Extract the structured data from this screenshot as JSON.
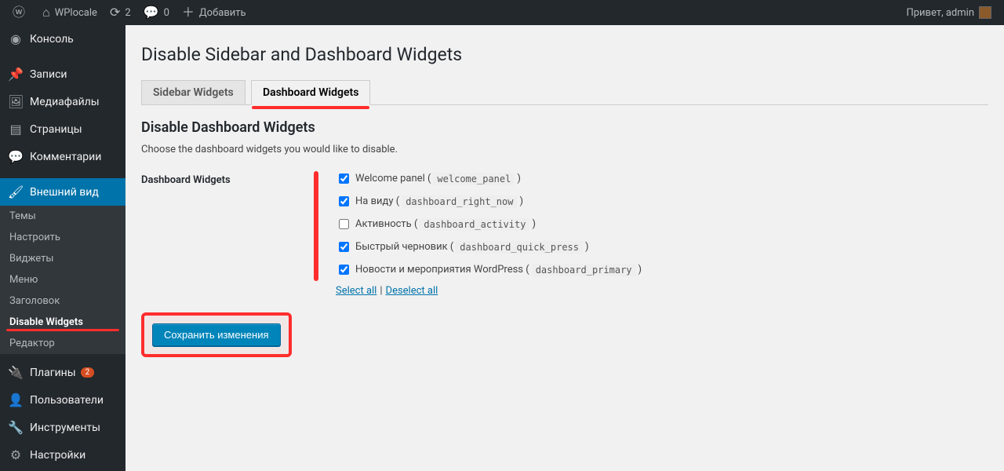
{
  "adminbar": {
    "site_name": "WPlocale",
    "updates": "2",
    "comments": "0",
    "add_new": "Добавить",
    "greeting": "Привет, admin"
  },
  "sidebar": {
    "dashboard": "Консоль",
    "posts": "Записи",
    "media": "Медиафайлы",
    "pages": "Страницы",
    "comments": "Комментарии",
    "appearance": "Внешний вид",
    "appearance_sub": {
      "themes": "Темы",
      "customize": "Настроить",
      "widgets": "Виджеты",
      "menus": "Меню",
      "header": "Заголовок",
      "disable_widgets": "Disable Widgets",
      "editor": "Редактор"
    },
    "plugins": "Плагины",
    "plugins_badge": "2",
    "users": "Пользователи",
    "tools": "Инструменты",
    "settings": "Настройки"
  },
  "page": {
    "title": "Disable Sidebar and Dashboard Widgets",
    "tabs": {
      "sidebar": "Sidebar Widgets",
      "dashboard": "Dashboard Widgets"
    },
    "section_title": "Disable Dashboard Widgets",
    "section_desc": "Choose the dashboard widgets you would like to disable.",
    "row_label": "Dashboard Widgets",
    "widgets": [
      {
        "label": "Welcome panel",
        "code": "welcome_panel",
        "checked": true
      },
      {
        "label": "На виду",
        "code": "dashboard_right_now",
        "checked": true
      },
      {
        "label": "Активность",
        "code": "dashboard_activity",
        "checked": false
      },
      {
        "label": "Быстрый черновик",
        "code": "dashboard_quick_press",
        "checked": true
      },
      {
        "label": "Новости и мероприятия WordPress",
        "code": "dashboard_primary",
        "checked": true
      }
    ],
    "select_all": "Select all",
    "deselect_all": "Deselect all",
    "submit": "Сохранить изменения"
  }
}
